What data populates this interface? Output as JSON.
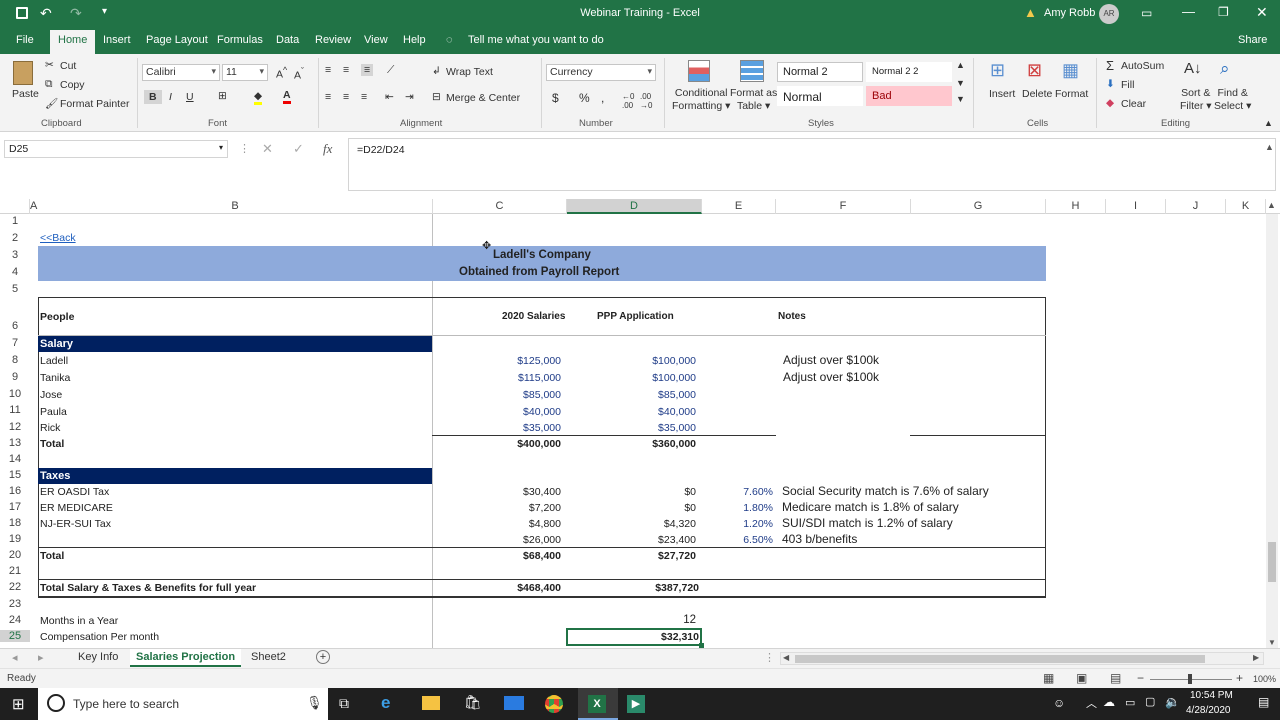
{
  "window": {
    "title": "Webinar Training  -  Excel",
    "user": "Amy Robb",
    "user_initials": "AR"
  },
  "menu": [
    "File",
    "Home",
    "Insert",
    "Page Layout",
    "Formulas",
    "Data",
    "Review",
    "View",
    "Help"
  ],
  "tell_me": "Tell me what you want to do",
  "share": "Share",
  "ribbon": {
    "clipboard": {
      "paste": "Paste",
      "cut": "Cut",
      "copy": "Copy",
      "format_painter": "Format Painter",
      "label": "Clipboard"
    },
    "font": {
      "name": "Calibri",
      "size": "11",
      "label": "Font"
    },
    "alignment": {
      "wrap": "Wrap Text",
      "merge": "Merge & Center",
      "label": "Alignment"
    },
    "number": {
      "format": "Currency",
      "dollar": "$",
      "percent": "%",
      "comma": ",",
      "label": "Number"
    },
    "styles": {
      "cond_line1": "Conditional",
      "cond_line2": "Formatting",
      "table_line1": "Format as",
      "table_line2": "Table",
      "normal2": "Normal 2",
      "normal22": "Normal 2 2",
      "normal": "Normal",
      "bad": "Bad",
      "label": "Styles"
    },
    "cells": {
      "insert": "Insert",
      "delete": "Delete",
      "format": "Format",
      "label": "Cells"
    },
    "editing": {
      "autosum": "AutoSum",
      "fill": "Fill",
      "clear": "Clear",
      "sort_line1": "Sort &",
      "sort_line2": "Filter",
      "find_line1": "Find &",
      "find_line2": "Select",
      "label": "Editing"
    }
  },
  "formula_bar": {
    "name_box": "D25",
    "formula": "=D22/D24",
    "fx": "fx"
  },
  "columns": [
    "A",
    "B",
    "C",
    "D",
    "E",
    "F",
    "G",
    "H",
    "I",
    "J",
    "K"
  ],
  "rows": [
    "1",
    "2",
    "3",
    "4",
    "5",
    "6",
    "7",
    "8",
    "9",
    "10",
    "11",
    "12",
    "13",
    "14",
    "15",
    "16",
    "17",
    "18",
    "19",
    "20",
    "21",
    "22",
    "23",
    "24",
    "25"
  ],
  "sheet": {
    "back_link": "<<Back",
    "company": "Ladell's Company",
    "subtitle": "Obtained from Payroll Report",
    "headers": {
      "people": "People",
      "salaries": "2020 Salaries",
      "ppp": "PPP Application",
      "notes": "Notes"
    },
    "salary_section": "Salary",
    "salaries": [
      {
        "name": "Ladell",
        "s2020": "$125,000",
        "ppp": "$100,000",
        "note": "Adjust over $100k"
      },
      {
        "name": "Tanika",
        "s2020": "$115,000",
        "ppp": "$100,000",
        "note": "Adjust over $100k"
      },
      {
        "name": "Jose",
        "s2020": "$85,000",
        "ppp": "$85,000",
        "note": ""
      },
      {
        "name": "Paula",
        "s2020": "$40,000",
        "ppp": "$40,000",
        "note": ""
      },
      {
        "name": "Rick",
        "s2020": "$35,000",
        "ppp": "$35,000",
        "note": ""
      }
    ],
    "salary_total": {
      "label": "Total",
      "s2020": "$400,000",
      "ppp": "$360,000"
    },
    "taxes_section": "Taxes",
    "taxes": [
      {
        "name": "ER OASDI  Tax",
        "s2020": "$30,400",
        "ppp": "$0",
        "pct": "7.60%",
        "note": "Social Security  match is 7.6% of salary"
      },
      {
        "name": "ER MEDICARE",
        "s2020": "$7,200",
        "ppp": "$0",
        "pct": "1.80%",
        "note": "Medicare match is 1.8% of salary"
      },
      {
        "name": "NJ-ER-SUI Tax",
        "s2020": "$4,800",
        "ppp": "$4,320",
        "pct": "1.20%",
        "note": "SUI/SDI match is 1.2% of salary"
      },
      {
        "name": "",
        "s2020": "$26,000",
        "ppp": "$23,400",
        "pct": "6.50%",
        "note": "403 b/benefits"
      }
    ],
    "taxes_total": {
      "label": "Total",
      "s2020": "$68,400",
      "ppp": "$27,720"
    },
    "grand_total": {
      "label": "Total Salary & Taxes & Benefits for full year",
      "s2020": "$468,400",
      "ppp": "$387,720"
    },
    "months": {
      "label": "Months in a Year",
      "value": "12"
    },
    "comp": {
      "label": "Compensation Per month",
      "value": "$32,310"
    }
  },
  "sheet_tabs": [
    "Key Info",
    "Salaries Projection",
    "Sheet2"
  ],
  "status": {
    "ready": "Ready",
    "zoom": "100%"
  },
  "taskbar": {
    "search": "Type here to search",
    "time": "10:54 PM",
    "date": "4/28/2020"
  },
  "colors": {
    "excel_green": "#217346",
    "section_navy": "#002060",
    "title_band": "#8eaadb",
    "bad_fill": "#ffc7ce"
  }
}
